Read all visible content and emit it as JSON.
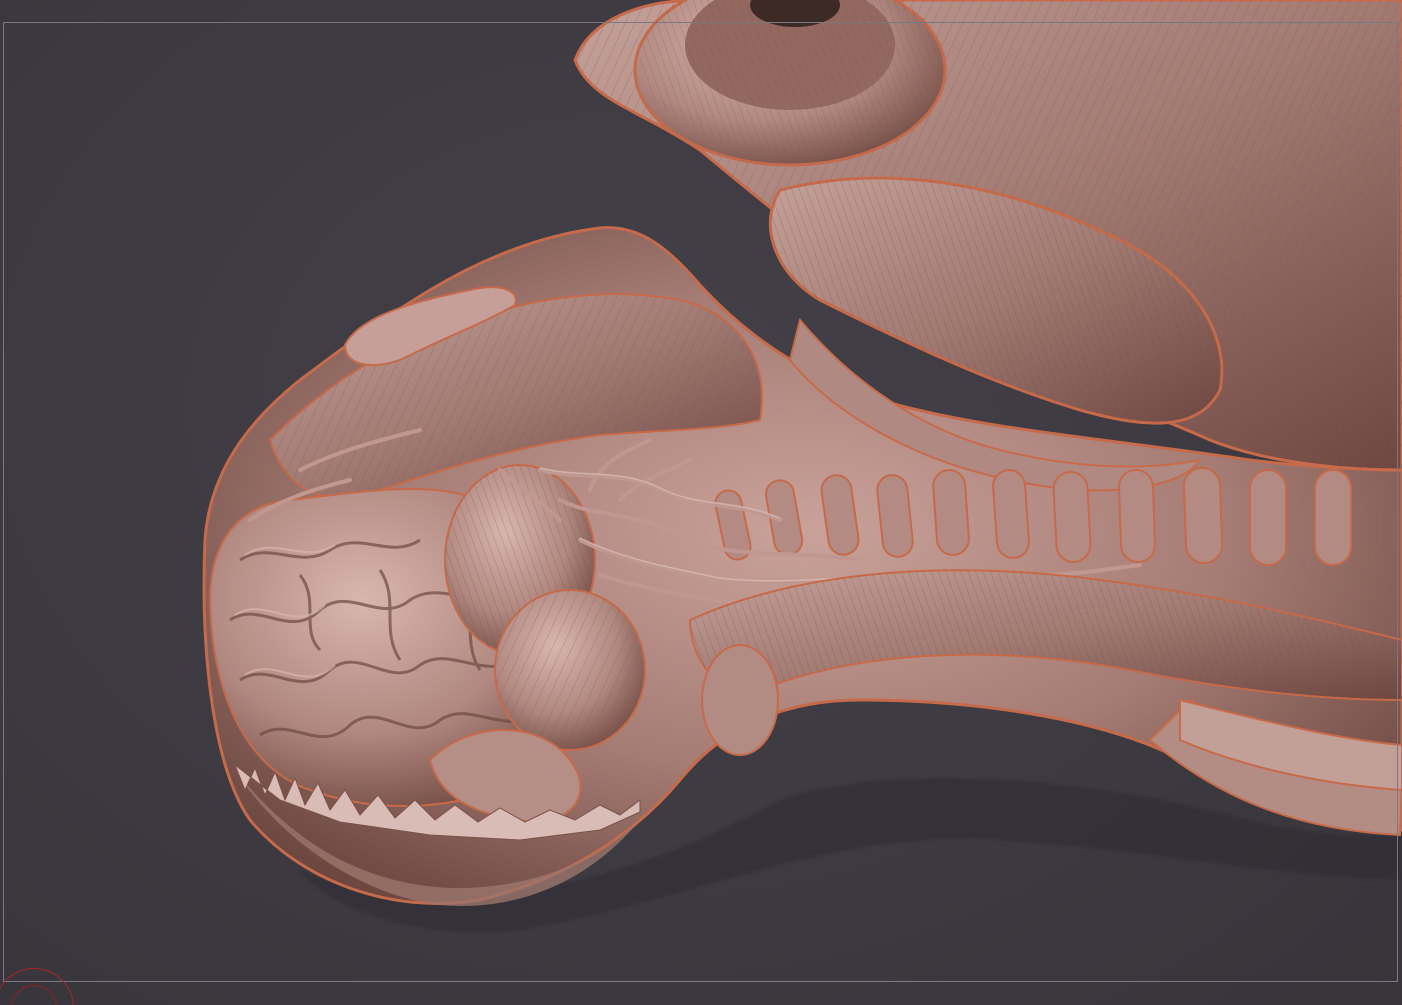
{
  "app": {
    "canvas_background": "#3c3a3e",
    "frame_color": "#7a7880"
  },
  "viewport": {
    "subject": "sculpt-mesh",
    "material_base": "#b98d84",
    "material_shadow": "#5a3a34",
    "material_rim": "#c96a4a"
  },
  "gizmo": {
    "color": "#a7262a",
    "icon": "navigation-gizmo-icon"
  }
}
